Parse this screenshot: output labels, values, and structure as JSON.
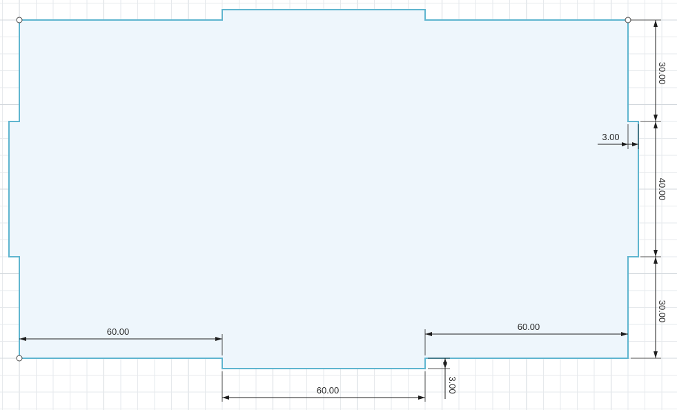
{
  "sketch": {
    "colors": {
      "background": "#ffffff",
      "profile_fill": "#eef6fc",
      "profile_stroke": "#5fb5cf",
      "grid_minor": "#e6e9ec",
      "grid_major": "#d2d7dc",
      "dimension": "#1e1e1e"
    },
    "dimensions": {
      "right_upper_height": "30.00",
      "right_tab_height": "40.00",
      "right_lower_height": "30.00",
      "right_tab_depth": "3.00",
      "bottom_left_width": "60.00",
      "bottom_right_width": "60.00",
      "bottom_tab_width": "60.00",
      "bottom_tab_depth": "3.00"
    }
  }
}
